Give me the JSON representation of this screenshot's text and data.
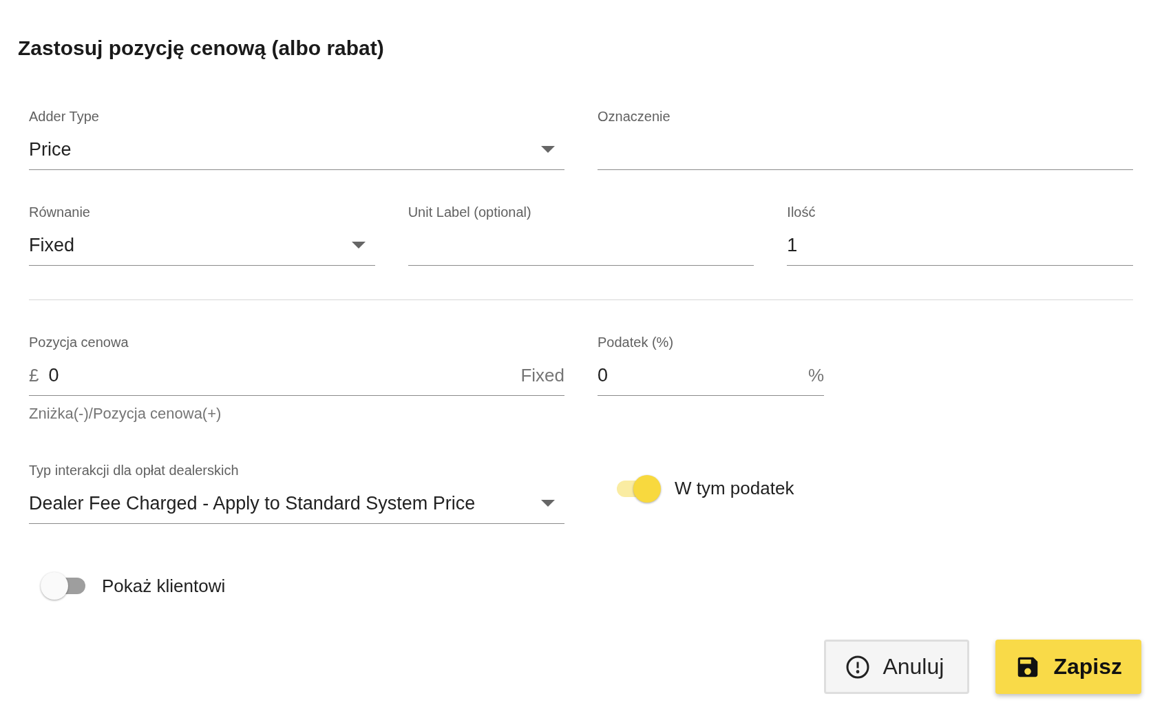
{
  "title": "Zastosuj pozycję cenową (albo rabat)",
  "row_1": [
    {
      "kind": "select",
      "label": "Adder Type",
      "value": "Price"
    },
    {
      "kind": "text",
      "label": "Oznaczenie"
    }
  ],
  "row_2": [
    {
      "kind": "select",
      "label": "Równanie",
      "value": "Fixed"
    },
    {
      "kind": "text",
      "label": "Unit Label (optional)"
    },
    {
      "kind": "text",
      "label": "Ilość",
      "value": "1"
    }
  ],
  "price": {
    "label": "Pozycja cenowa",
    "prefix": "£",
    "value": "0",
    "suffix": "Fixed",
    "helper": "Zniżka(-)/Pozycja cenowa(+)"
  },
  "tax": {
    "label": "Podatek (%)",
    "value": "0",
    "suffix": "%"
  },
  "dealer_fee": {
    "kind": "select",
    "label": "Typ interakcji dla opłat dealerskich",
    "value": "Dealer Fee Charged - Apply to Standard System Price"
  },
  "tax_included": {
    "label": "W tym podatek",
    "on": true
  },
  "show_client": {
    "label": "Pokaż klientowi",
    "on": false
  },
  "buttons": [
    {
      "kind": "cancel",
      "label": "Anuluj"
    },
    {
      "kind": "save",
      "label": "Zapisz"
    }
  ]
}
